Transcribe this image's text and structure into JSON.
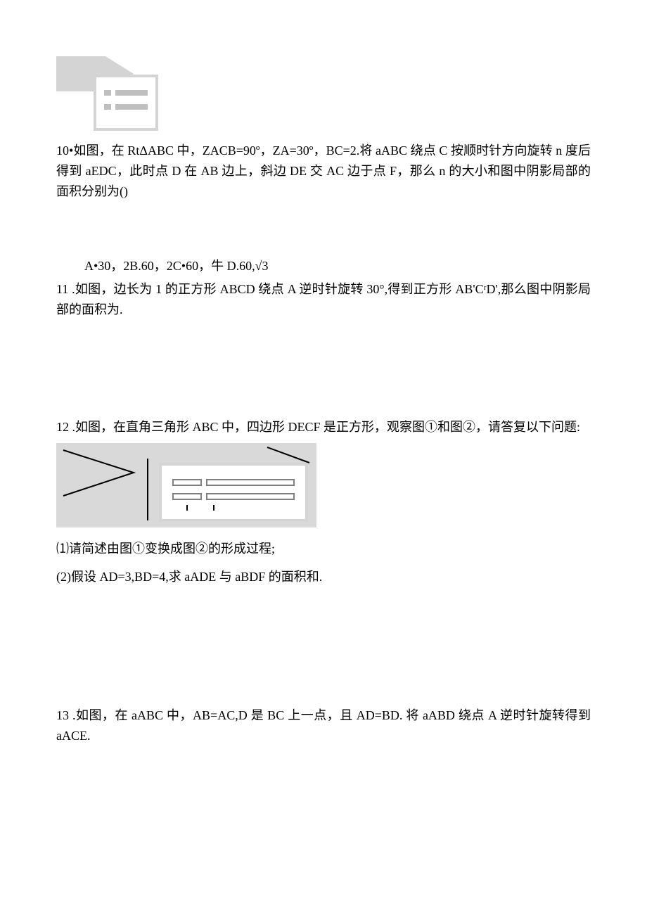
{
  "q10": {
    "text": "10•如图，在 RtΔABC 中，ZACB=90º，ZA=30º，BC=2.将 aABC 绕点 C 按顺时针方向旋转 n 度后得到 aEDC，此时点 D 在 AB 边上，斜边 DE 交 AC 边于点 F，那么 n 的大小和图中阴影局部的面积分别为()",
    "options": "A•30，2B.60，2C•60，牛 D.60,√3"
  },
  "q11": {
    "text": "11 .如图，边长为 1 的正方形 ABCD 绕点 A 逆时针旋转 30°,得到正方形 AB'CʳD',那么图中阴影局部的面积为."
  },
  "q12": {
    "text": "12 .如图，在直角三角形 ABC 中，四边形 DECF 是正方形，观察图①和图②，请答复以下问题:",
    "sub1": "⑴请简述由图①变换成图②的形成过程;",
    "sub2": "(2)假设 AD=3,BD=4,求 aADE 与 aBDF 的面积和."
  },
  "q13": {
    "text": "13 .如图，在 aABC 中，AB=AC,D 是 BC 上一点，且 AD=BD. 将 aABD 绕点 A 逆时针旋转得到 aACE."
  }
}
